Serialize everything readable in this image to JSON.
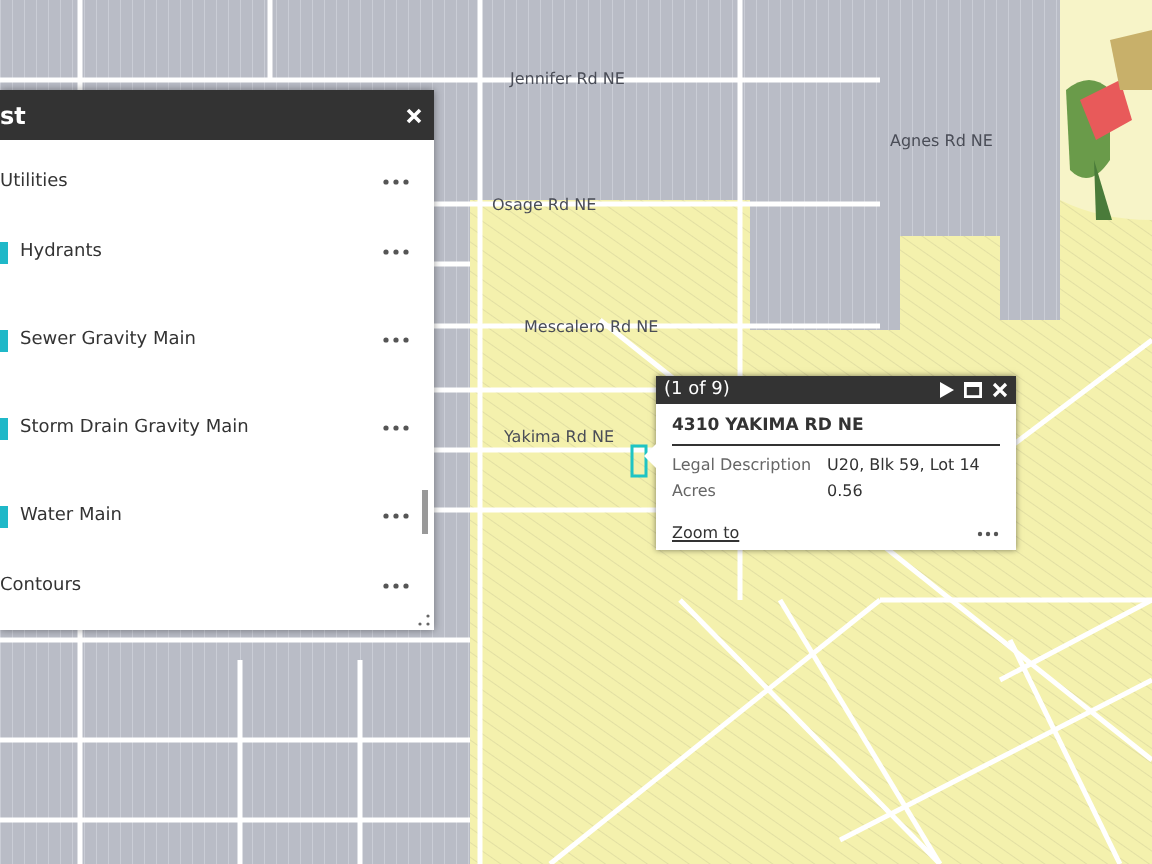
{
  "map": {
    "street_labels": [
      "Jennifer Rd NE",
      "Agnes Rd NE",
      "Osage Rd NE",
      "Mescalero Rd NE",
      "Yakima Rd NE"
    ]
  },
  "layer_list": {
    "title": "st",
    "layers": [
      {
        "name": "Utilities",
        "children": [
          {
            "name": "Hydrants",
            "checked": true
          },
          {
            "name": "Sewer Gravity Main",
            "checked": true
          },
          {
            "name": "Storm Drain Gravity Main",
            "checked": true
          },
          {
            "name": "Water Main",
            "checked": true
          }
        ]
      },
      {
        "name": "Contours"
      }
    ]
  },
  "popup": {
    "counter": "(1 of 9)",
    "title": "4310 YAKIMA RD NE",
    "fields": [
      {
        "label": "Legal Description",
        "value": "U20, Blk 59, Lot 14"
      },
      {
        "label": "Acres",
        "value": "0.56"
      }
    ],
    "link": "Zoom to"
  }
}
